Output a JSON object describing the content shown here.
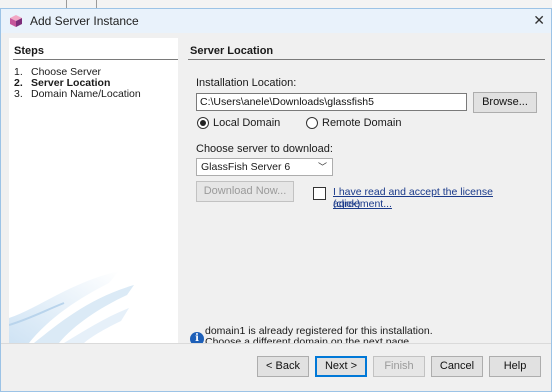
{
  "window": {
    "title": "Add Server Instance",
    "close_glyph": "✕"
  },
  "steps": {
    "heading": "Steps",
    "items": [
      {
        "num": "1.",
        "label": "Choose Server"
      },
      {
        "num": "2.",
        "label": "Server Location"
      },
      {
        "num": "3.",
        "label": "Domain Name/Location"
      }
    ]
  },
  "main": {
    "heading": "Server Location",
    "install_label": "Installation Location:",
    "install_value": "C:\\Users\\anele\\Downloads\\glassfish5",
    "browse_label": "Browse...",
    "radio_local": "Local Domain",
    "radio_remote": "Remote Domain",
    "choose_label": "Choose server to download:",
    "server_selected": "GlassFish Server 6",
    "download_label": "Download Now...",
    "license_line1": "I have read and accept the license agreement...",
    "license_line2": "(click)",
    "info_line1": "domain1 is already registered for this installation.",
    "info_line2": "Choose a different domain on the next page."
  },
  "buttons": {
    "back": "< Back",
    "next": "Next >",
    "finish": "Finish",
    "cancel": "Cancel",
    "help": "Help"
  },
  "icons": {
    "app": "netbeans-cube-icon",
    "info": "info-icon",
    "dropdown": "chevron-down-icon"
  }
}
